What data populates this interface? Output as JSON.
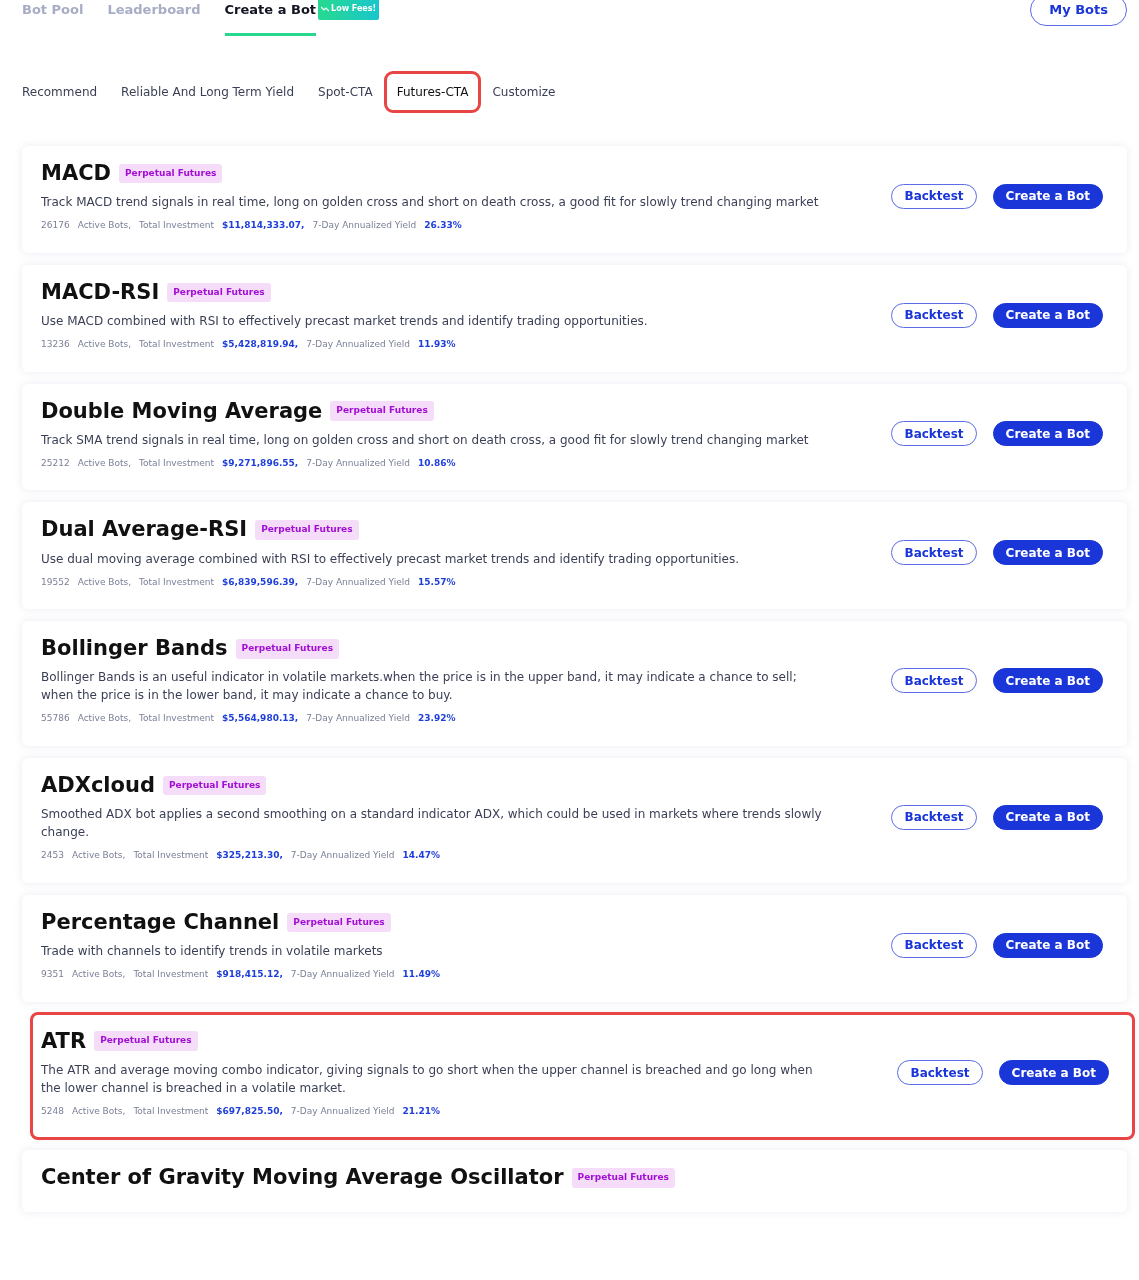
{
  "top_tabs": [
    {
      "label": "Bot Pool",
      "selected": false
    },
    {
      "label": "Leaderboard",
      "selected": false
    },
    {
      "label": "Create a Bot",
      "selected": true,
      "badge": "Low Fees!"
    }
  ],
  "my_bots_button": "My Bots",
  "category_tabs": [
    {
      "label": "Recommend",
      "selected": false,
      "highlighted": false
    },
    {
      "label": "Reliable And Long Term Yield",
      "selected": false,
      "highlighted": false
    },
    {
      "label": "Spot-CTA",
      "selected": false,
      "highlighted": false
    },
    {
      "label": "Futures-CTA",
      "selected": true,
      "highlighted": true
    },
    {
      "label": "Customize",
      "selected": false,
      "highlighted": false
    }
  ],
  "bots": [
    {
      "name": "MACD",
      "tag": "Perpetual Futures",
      "description": "Track MACD trend signals in real time, long on golden cross and short on death cross, a good fit for slowly trend changing market",
      "active_bots": "26176",
      "active_bots_label": "Active Bots,",
      "total_investment_label": "Total Investment",
      "total_investment": "$11,814,333.07,",
      "yield_label": "7-Day Annualized Yield",
      "yield": "26.33%",
      "highlighted": false,
      "buttons": [
        "Backtest",
        "Create a Bot"
      ]
    },
    {
      "name": "MACD-RSI",
      "tag": "Perpetual Futures",
      "description": "Use MACD combined with RSI to effectively precast market trends and identify trading opportunities.",
      "active_bots": "13236",
      "active_bots_label": "Active Bots,",
      "total_investment_label": "Total Investment",
      "total_investment": "$5,428,819.94,",
      "yield_label": "7-Day Annualized Yield",
      "yield": "11.93%",
      "highlighted": false,
      "buttons": [
        "Backtest",
        "Create a Bot"
      ]
    },
    {
      "name": "Double Moving Average",
      "tag": "Perpetual Futures",
      "description": "Track SMA trend signals in real time, long on golden cross and short on death cross, a good fit for slowly trend changing market",
      "active_bots": "25212",
      "active_bots_label": "Active Bots,",
      "total_investment_label": "Total Investment",
      "total_investment": "$9,271,896.55,",
      "yield_label": "7-Day Annualized Yield",
      "yield": "10.86%",
      "highlighted": false,
      "buttons": [
        "Backtest",
        "Create a Bot"
      ]
    },
    {
      "name": "Dual Average-RSI",
      "tag": "Perpetual Futures",
      "description": "Use dual moving average combined with RSI to effectively precast market trends and identify trading opportunities.",
      "active_bots": "19552",
      "active_bots_label": "Active Bots,",
      "total_investment_label": "Total Investment",
      "total_investment": "$6,839,596.39,",
      "yield_label": "7-Day Annualized Yield",
      "yield": "15.57%",
      "highlighted": false,
      "buttons": [
        "Backtest",
        "Create a Bot"
      ]
    },
    {
      "name": "Bollinger Bands",
      "tag": "Perpetual Futures",
      "description": "Bollinger Bands is an useful indicator in volatile markets.when the price is in the upper band, it may indicate a chance to sell; when the price is in the lower band, it may indicate a chance to buy.",
      "active_bots": "55786",
      "active_bots_label": "Active Bots,",
      "total_investment_label": "Total Investment",
      "total_investment": "$5,564,980.13,",
      "yield_label": "7-Day Annualized Yield",
      "yield": "23.92%",
      "highlighted": false,
      "buttons": [
        "Backtest",
        "Create a Bot"
      ]
    },
    {
      "name": "ADXcloud",
      "tag": "Perpetual Futures",
      "description": "Smoothed ADX bot applies a second smoothing on a standard indicator ADX, which could be used in markets where trends slowly change.",
      "active_bots": "2453",
      "active_bots_label": "Active Bots,",
      "total_investment_label": "Total Investment",
      "total_investment": "$325,213.30,",
      "yield_label": "7-Day Annualized Yield",
      "yield": "14.47%",
      "highlighted": false,
      "buttons": [
        "Backtest",
        "Create a Bot"
      ]
    },
    {
      "name": "Percentage Channel",
      "tag": "Perpetual Futures",
      "description": "Trade with channels to identify trends in volatile markets",
      "active_bots": "9351",
      "active_bots_label": "Active Bots,",
      "total_investment_label": "Total Investment",
      "total_investment": "$918,415.12,",
      "yield_label": "7-Day Annualized Yield",
      "yield": "11.49%",
      "highlighted": false,
      "buttons": [
        "Backtest",
        "Create a Bot"
      ]
    },
    {
      "name": "ATR",
      "tag": "Perpetual Futures",
      "description": "The ATR and average moving combo indicator, giving signals to go short when the upper channel is breached and go long when the lower channel is breached in a volatile market.",
      "active_bots": "5248",
      "active_bots_label": "Active Bots,",
      "total_investment_label": "Total Investment",
      "total_investment": "$697,825.50,",
      "yield_label": "7-Day Annualized Yield",
      "yield": "21.21%",
      "highlighted": true,
      "buttons": [
        "Backtest",
        "Create a Bot"
      ]
    },
    {
      "name": "Center of Gravity Moving Average Oscillator",
      "tag": "Perpetual Futures",
      "highlighted": false
    }
  ]
}
